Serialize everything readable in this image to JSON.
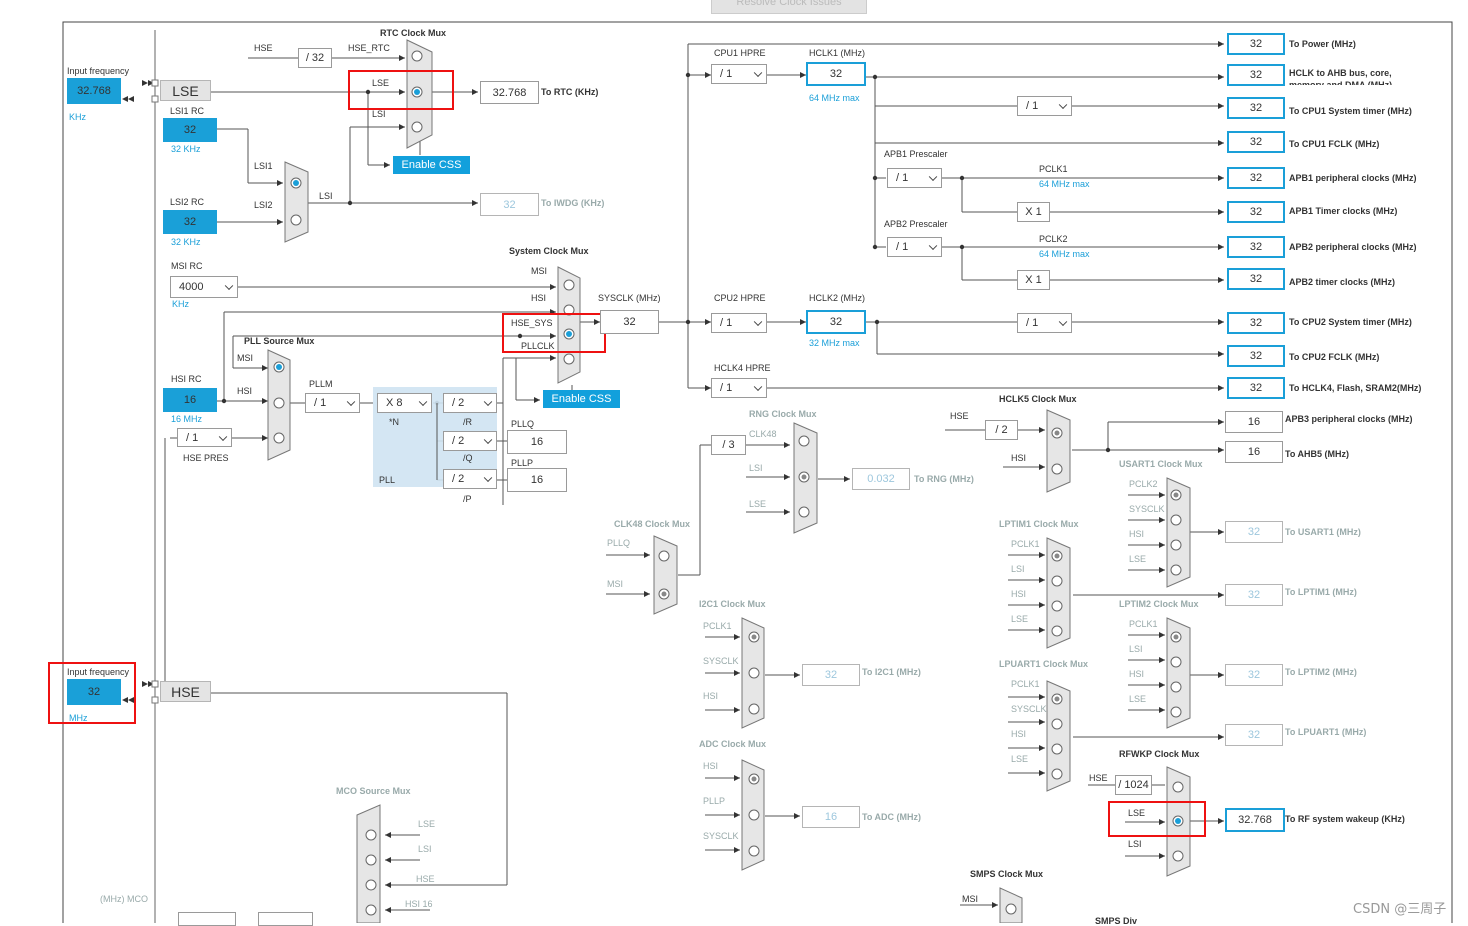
{
  "toolbar": {
    "resolve_label": "Resolve Clock Issues"
  },
  "watermark": "CSDN @三周子",
  "lse_input": {
    "caption": "Input frequency",
    "value": "32.768",
    "unit": "KHz",
    "source": "LSE"
  },
  "hse_input": {
    "caption": "Input frequency",
    "value": "32",
    "unit": "MHz",
    "source": "HSE"
  },
  "lsi1": {
    "title": "LSI1 RC",
    "value": "32",
    "unit": "32 KHz"
  },
  "lsi2": {
    "title": "LSI2 RC",
    "value": "32",
    "unit": "32 KHz"
  },
  "lsi_mux": {
    "in1": "LSI1",
    "in2": "LSI2",
    "out": "LSI"
  },
  "msi": {
    "title": "MSI RC",
    "value": "4000",
    "unit": "KHz"
  },
  "hsi": {
    "title": "HSI RC",
    "value": "16",
    "unit": "16 MHz"
  },
  "hse_pres": {
    "value": "/ 1",
    "label": "HSE PRES"
  },
  "rtc_mux": {
    "title": "RTC Clock Mux",
    "hse": "HSE",
    "div": "/ 32",
    "hse_rtc": "HSE_RTC",
    "lse": "LSE",
    "lsi": "LSI",
    "css": "Enable CSS",
    "out_value": "32.768",
    "out_label": "To RTC (KHz)"
  },
  "iwdg": {
    "value": "32",
    "label": "To IWDG (KHz)",
    "lsi": "LSI"
  },
  "sys_mux": {
    "title": "System Clock Mux",
    "msi": "MSI",
    "hsi": "HSI",
    "hse_sys": "HSE_SYS",
    "pllclk": "PLLCLK",
    "css": "Enable CSS",
    "sysclk_label": "SYSCLK (MHz)",
    "sysclk": "32"
  },
  "pll_mux": {
    "title": "PLL Source Mux",
    "msi": "MSI",
    "hsi": "HSI",
    "pllm_label": "PLLM",
    "pllm": "/ 1",
    "n": "X 8",
    "n_label": "*N",
    "r": "/ 2",
    "r_label": "/R",
    "q": "/ 2",
    "q_label": "/Q",
    "p": "/ 2",
    "p_label": "/P",
    "pll_label": "PLL",
    "pllq_label": "PLLQ",
    "pllq": "16",
    "pllp_label": "PLLP",
    "pllp": "16"
  },
  "cpu1": {
    "hpre_label": "CPU1 HPRE",
    "hpre": "/ 1",
    "hclk1_label": "HCLK1 (MHz)",
    "hclk1": "32",
    "hclk1_max": "64 MHz max",
    "timer_div": "/ 1"
  },
  "apb1": {
    "label": "APB1 Prescaler",
    "div": "/ 1",
    "pclk": "PCLK1",
    "max": "64 MHz max",
    "mul": "X 1"
  },
  "apb2": {
    "label": "APB2 Prescaler",
    "div": "/ 1",
    "pclk": "PCLK2",
    "max": "64 MHz max",
    "mul": "X 1"
  },
  "cpu2": {
    "hpre_label": "CPU2 HPRE",
    "hpre": "/ 1",
    "hclk2_label": "HCLK2 (MHz)",
    "hclk2": "32",
    "hclk2_max": "32 MHz max",
    "timer_div": "/ 1"
  },
  "hclk4": {
    "hpre_label": "HCLK4 HPRE",
    "hpre": "/ 1"
  },
  "outputs": [
    {
      "value": "32",
      "label": "To Power (MHz)"
    },
    {
      "value": "32",
      "label": "HCLK to AHB bus, core, memory and DMA (MHz)"
    },
    {
      "value": "32",
      "label": "To CPU1 System timer (MHz)"
    },
    {
      "value": "32",
      "label": "To CPU1 FCLK (MHz)"
    },
    {
      "value": "32",
      "label": "APB1 peripheral clocks (MHz)"
    },
    {
      "value": "32",
      "label": "APB1 Timer clocks (MHz)"
    },
    {
      "value": "32",
      "label": "APB2 peripheral clocks (MHz)"
    },
    {
      "value": "32",
      "label": "APB2 timer clocks (MHz)"
    },
    {
      "value": "32",
      "label": "To CPU2 System timer (MHz)"
    },
    {
      "value": "32",
      "label": "To CPU2 FCLK (MHz)"
    },
    {
      "value": "32",
      "label": "To HCLK4, Flash, SRAM2(MHz)"
    }
  ],
  "hclk5": {
    "title": "HCLK5 Clock Mux",
    "hse": "HSE",
    "div": "/ 2",
    "hsi": "HSI",
    "apb3": "16",
    "apb3_label": "APB3 peripheral clocks (MHz)",
    "ahb5": "16",
    "ahb5_label": "To AHB5 (MHz)"
  },
  "rng": {
    "title": "RNG Clock Mux",
    "div": "/ 3",
    "clk48": "CLK48",
    "lsi": "LSI",
    "lse": "LSE",
    "value": "0.032",
    "label": "To RNG (MHz)"
  },
  "clk48": {
    "title": "CLK48 Clock Mux",
    "pllq": "PLLQ",
    "msi": "MSI"
  },
  "i2c1": {
    "title": "I2C1 Clock Mux",
    "in1": "PCLK1",
    "in2": "SYSCLK",
    "in3": "HSI",
    "value": "32",
    "label": "To I2C1 (MHz)"
  },
  "adc": {
    "title": "ADC Clock Mux",
    "in1": "HSI",
    "in2": "PLLP",
    "in3": "SYSCLK",
    "value": "16",
    "label": "To ADC (MHz)"
  },
  "usart1": {
    "title": "USART1 Clock Mux",
    "in1": "PCLK2",
    "in2": "SYSCLK",
    "in3": "HSI",
    "in4": "LSE",
    "value": "32",
    "label": "To USART1 (MHz)"
  },
  "lptim1": {
    "title": "LPTIM1 Clock Mux",
    "in1": "PCLK1",
    "in2": "LSI",
    "in3": "HSI",
    "in4": "LSE",
    "value": "32",
    "label": "To LPTIM1 (MHz)"
  },
  "lptim2": {
    "title": "LPTIM2 Clock Mux",
    "in1": "PCLK1",
    "in2": "LSI",
    "in3": "HSI",
    "in4": "LSE",
    "value": "32",
    "label": "To LPTIM2 (MHz)"
  },
  "lpuart1": {
    "title": "LPUART1 Clock Mux",
    "in1": "PCLK1",
    "in2": "SYSCLK",
    "in3": "HSI",
    "in4": "LSE",
    "value": "32",
    "label": "To LPUART1 (MHz)"
  },
  "rfwkp": {
    "title": "RFWKP Clock Mux",
    "hse": "HSE",
    "div": "/ 1024",
    "lse": "LSE",
    "lsi": "LSI",
    "value": "32.768",
    "label": "To RF system wakeup (KHz)"
  },
  "smps": {
    "title": "SMPS Clock Mux",
    "msi": "MSI",
    "div_label": "SMPS Div"
  },
  "mco": {
    "title": "MCO Source Mux",
    "in1": "LSE",
    "in2": "LSI",
    "in3": "HSE",
    "in4": "HSI 16",
    "label": "(MHz) MCO"
  }
}
